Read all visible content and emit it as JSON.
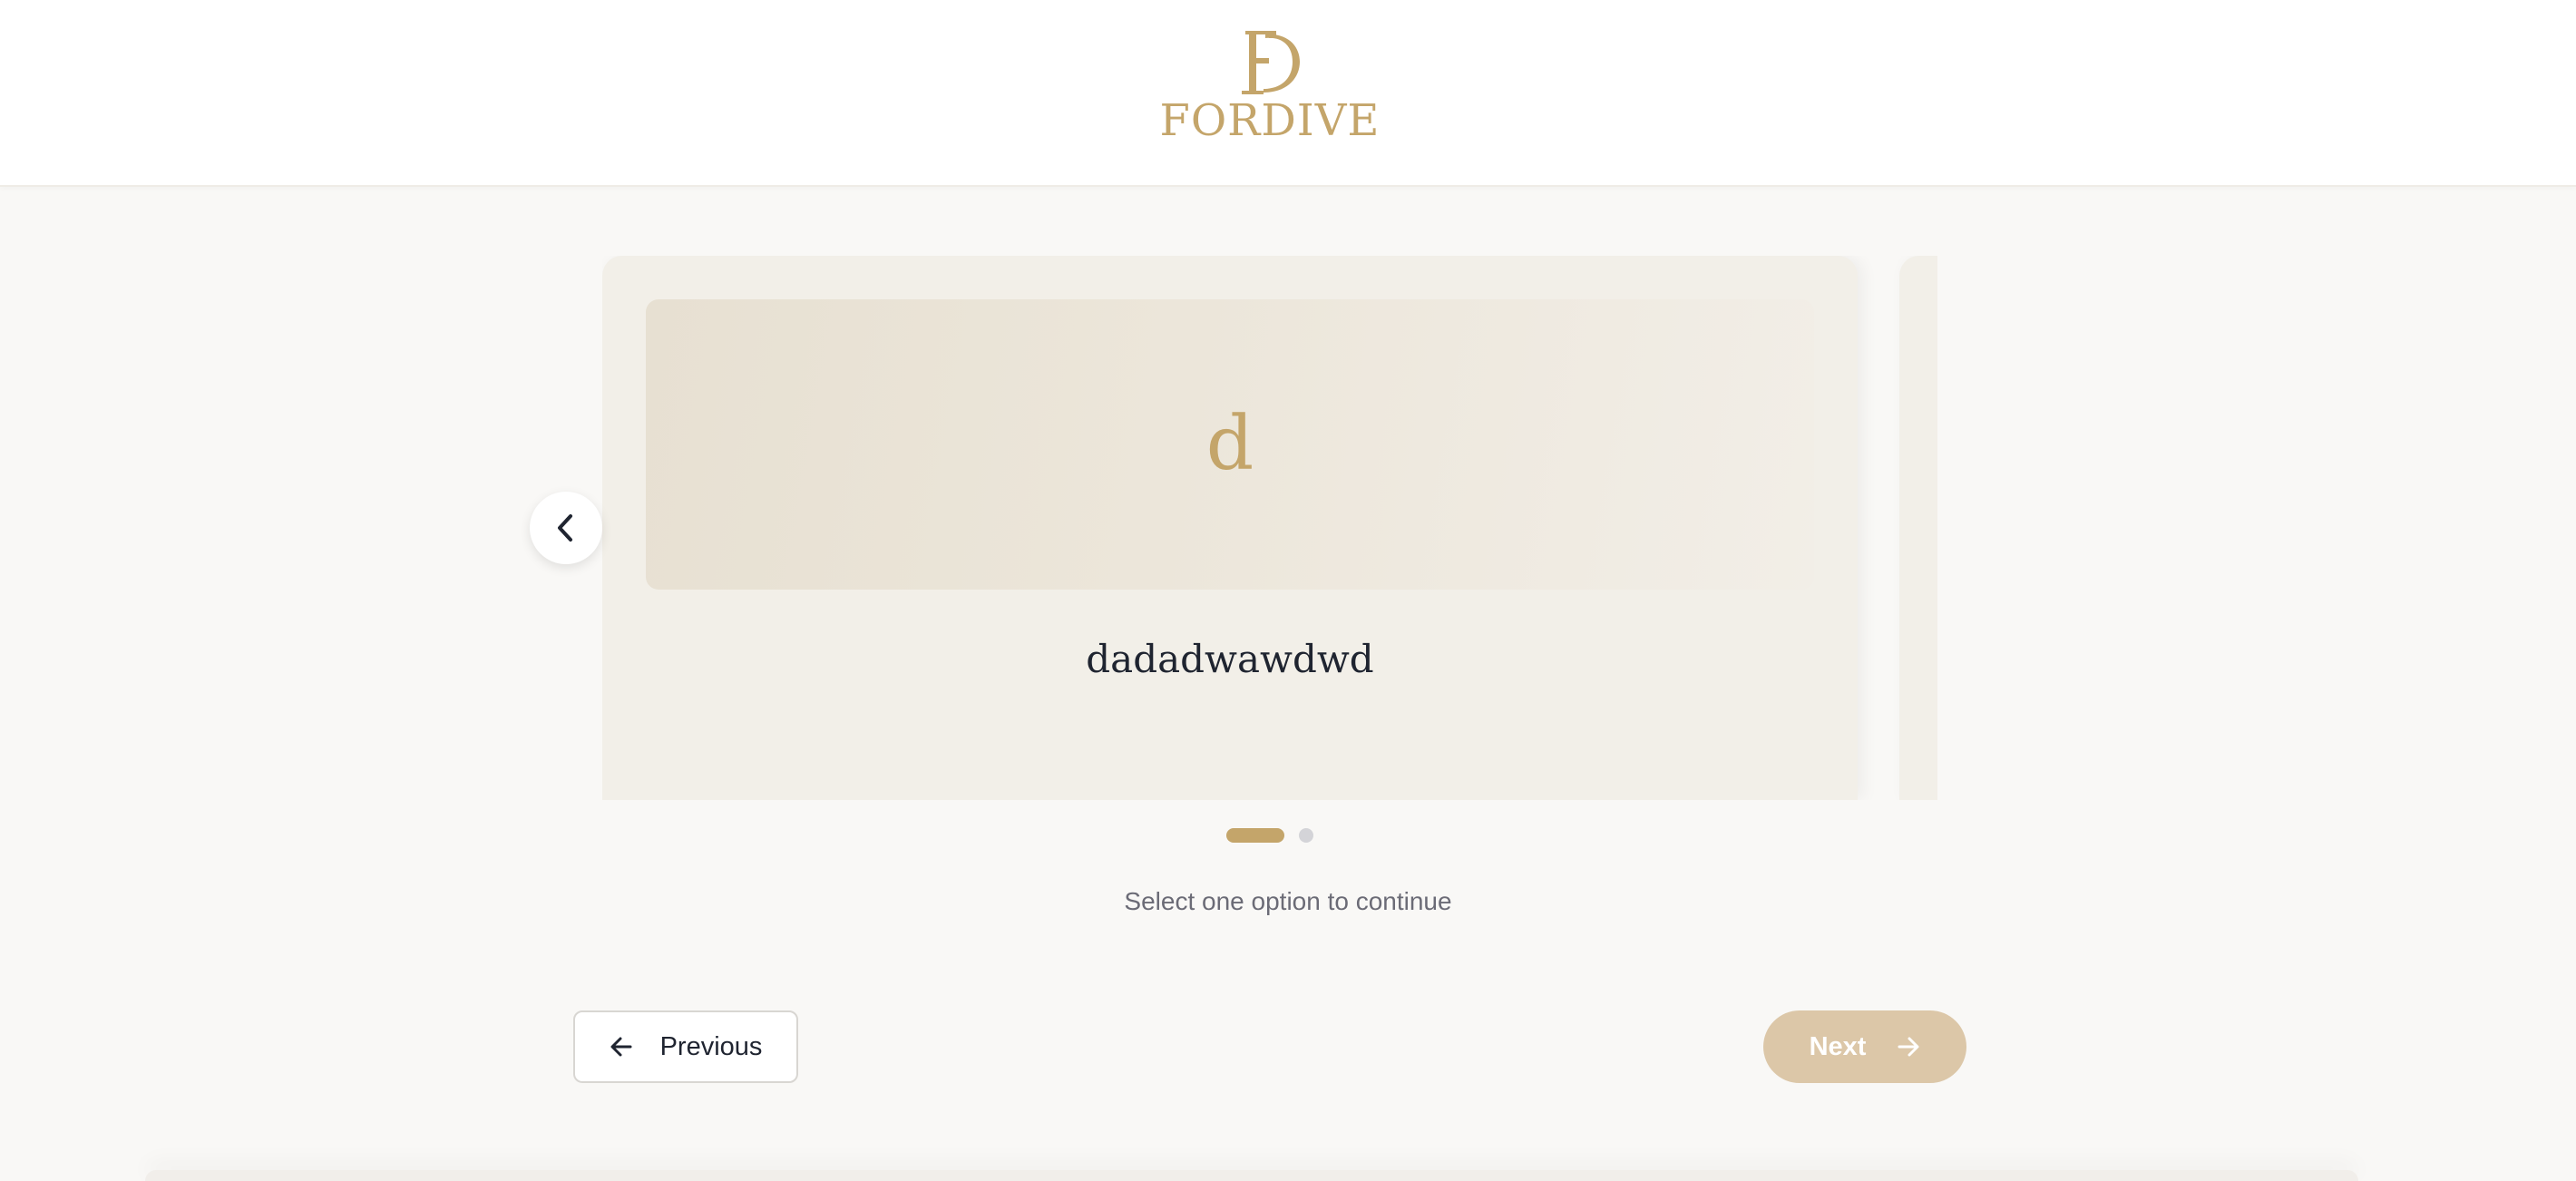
{
  "brand": {
    "name": "FORDIVE",
    "color": "#c4a56a"
  },
  "carousel": {
    "cards": [
      {
        "initial": "d",
        "title": "dadadwawdwd"
      }
    ],
    "prev_icon": "chevron-left-icon",
    "page_count": 2,
    "active_page": 1
  },
  "instruction": "Select one option to continue",
  "nav": {
    "previous_label": "Previous",
    "previous_icon": "arrow-left-icon",
    "next_label": "Next",
    "next_icon": "arrow-right-icon"
  },
  "colors": {
    "accent": "#c4a56a",
    "next_disabled": "#dcc7a8",
    "card_bg": "#f2efe8",
    "text": "#1f2430"
  }
}
